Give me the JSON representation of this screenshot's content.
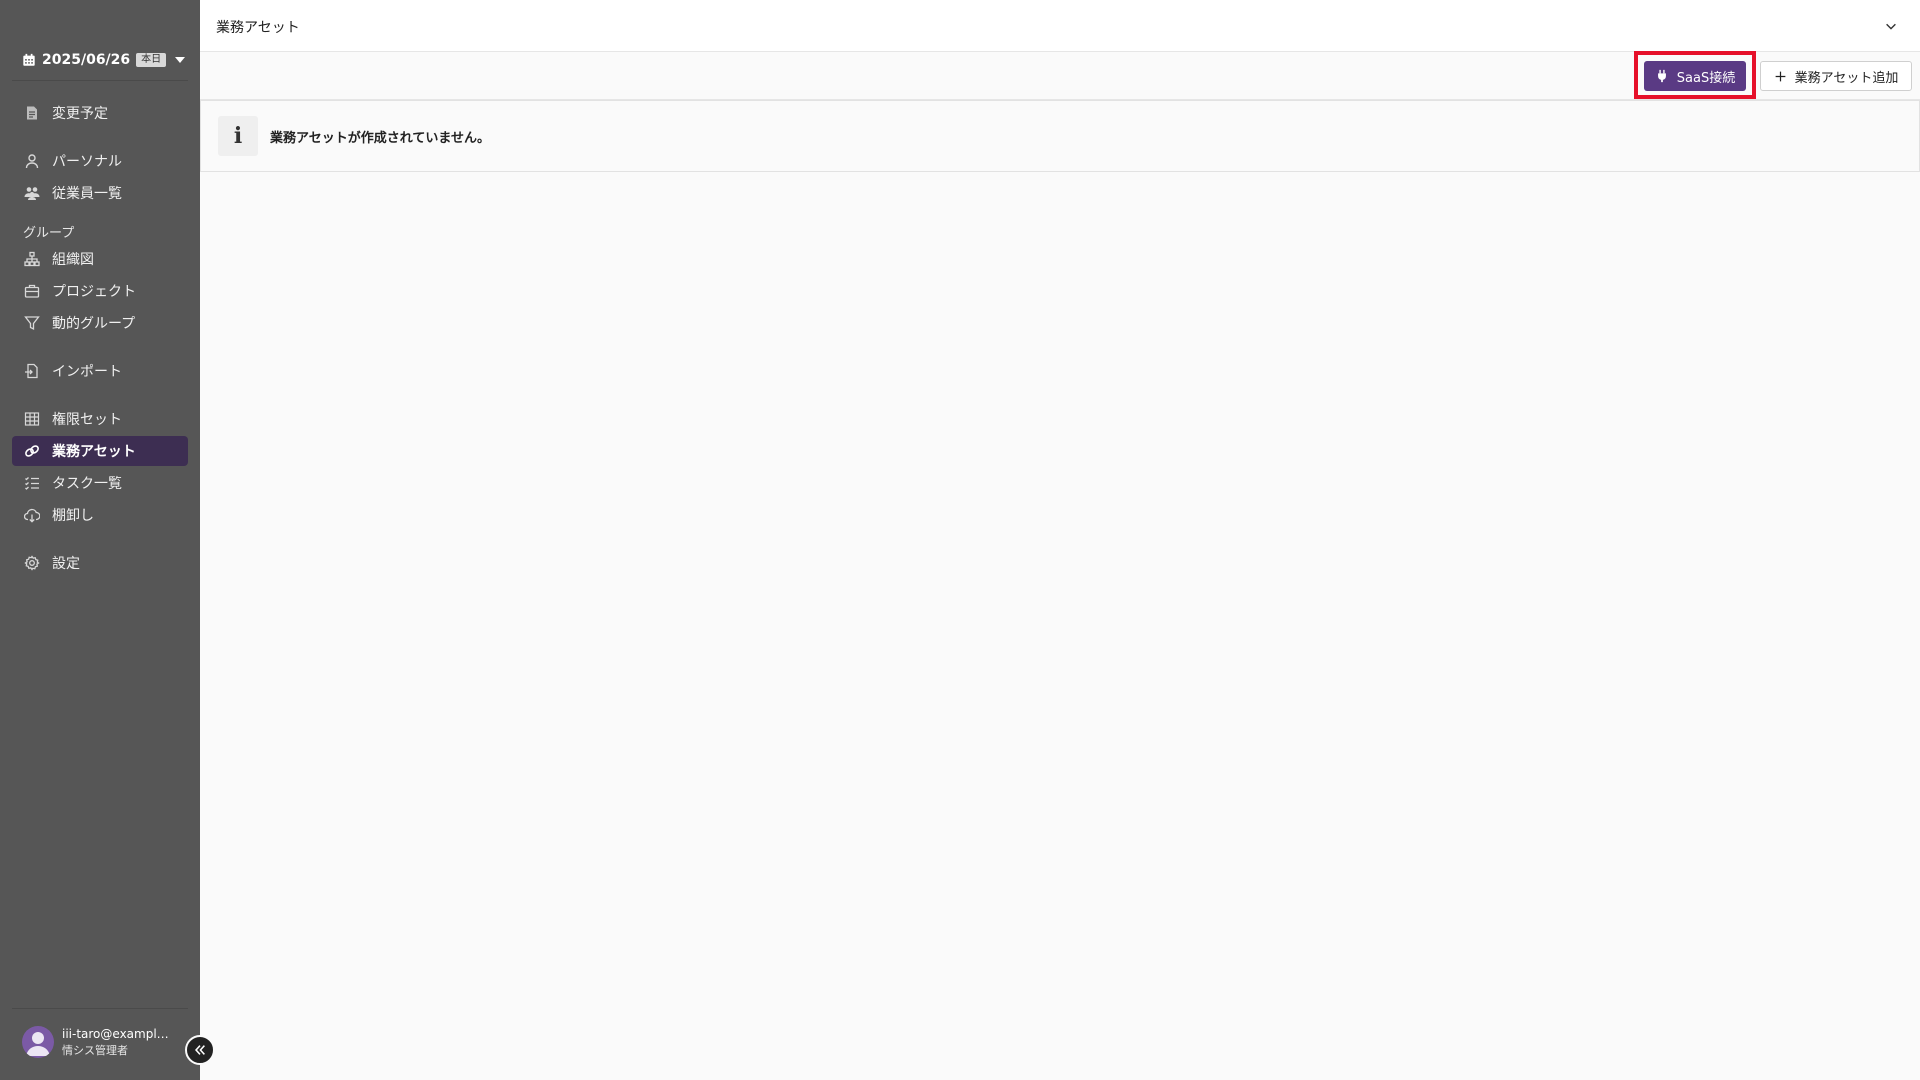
{
  "sidebar": {
    "date": "2025/06/26",
    "today_badge": "本日",
    "items": [
      {
        "label": "変更予定",
        "icon": "document-icon"
      },
      {
        "label": "パーソナル",
        "icon": "person-icon"
      },
      {
        "label": "従業員一覧",
        "icon": "people-icon"
      },
      {
        "label": "組織図",
        "icon": "org-chart-icon"
      },
      {
        "label": "プロジェクト",
        "icon": "briefcase-icon"
      },
      {
        "label": "動的グループ",
        "icon": "filter-icon"
      },
      {
        "label": "インポート",
        "icon": "import-icon"
      },
      {
        "label": "権限セット",
        "icon": "table-icon"
      },
      {
        "label": "業務アセット",
        "icon": "link-icon",
        "active": true
      },
      {
        "label": "タスク一覧",
        "icon": "checklist-icon"
      },
      {
        "label": "棚卸し",
        "icon": "cloud-download-icon"
      },
      {
        "label": "設定",
        "icon": "gear-icon"
      }
    ],
    "group_label": "グループ",
    "user": {
      "email": "iii-taro@example.com",
      "role": "情シス管理者"
    }
  },
  "header": {
    "title": "業務アセット"
  },
  "toolbar": {
    "saas_label": "SaaS接続",
    "add_label": "業務アセット追加"
  },
  "info": {
    "message": "業務アセットが作成されていません。"
  },
  "colors": {
    "sidebar_bg": "#565656",
    "active_item_bg": "#3d2e52",
    "primary_button": "#5a3a84",
    "highlight": "#e6102a"
  }
}
